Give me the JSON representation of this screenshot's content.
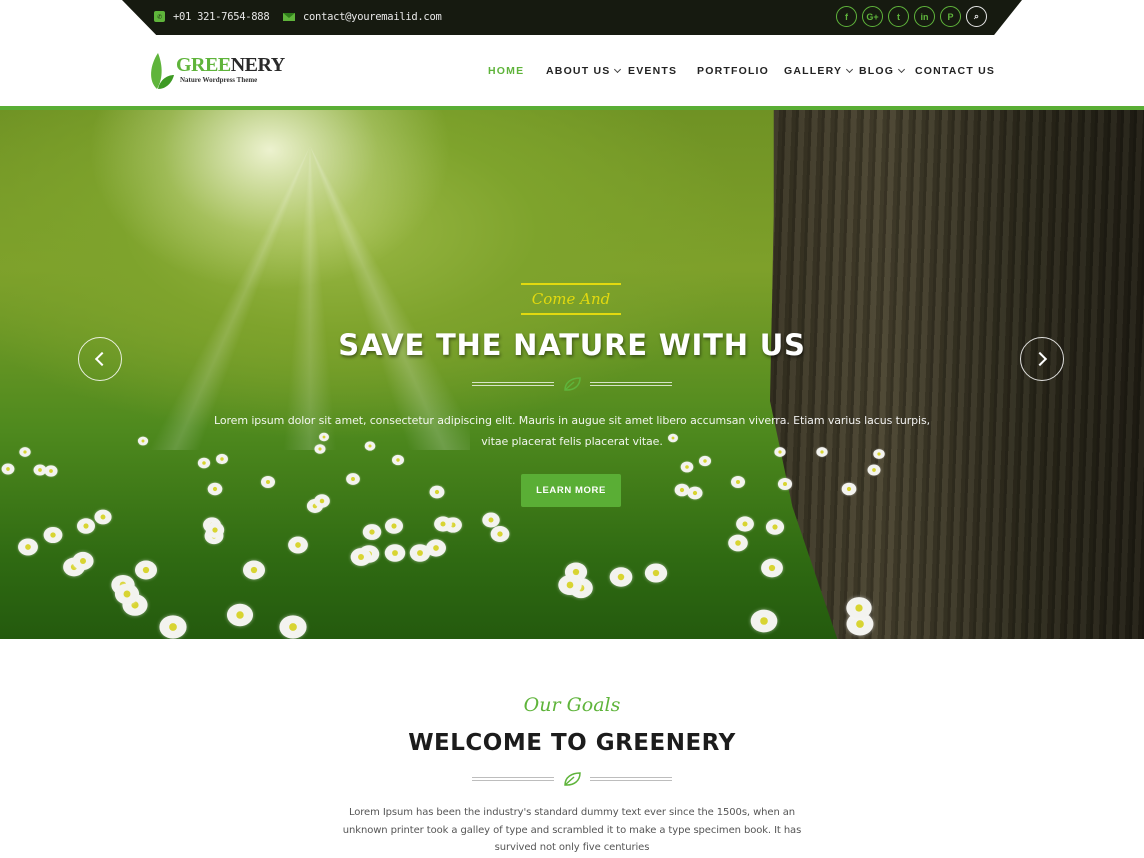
{
  "topbar": {
    "phone": "+01 321-7654-888",
    "email": "contact@youremailid.com",
    "phone_icon": "phone-icon",
    "email_icon": "envelope-icon",
    "socials": [
      {
        "name": "facebook",
        "glyph": "f"
      },
      {
        "name": "google-plus",
        "glyph": "G+"
      },
      {
        "name": "twitter",
        "glyph": "t"
      },
      {
        "name": "linkedin",
        "glyph": "in"
      },
      {
        "name": "pinterest",
        "glyph": "P"
      }
    ],
    "search_glyph": "⌕"
  },
  "logo": {
    "title_part1": "GREE",
    "title_part2": "NERY",
    "subtitle": "Nature Wordpress Theme"
  },
  "nav": {
    "items": [
      {
        "label": "HOME",
        "active": true,
        "dropdown": false
      },
      {
        "label": "ABOUT US",
        "active": false,
        "dropdown": true
      },
      {
        "label": "EVENTS",
        "active": false,
        "dropdown": false
      },
      {
        "label": "PORTFOLIO",
        "active": false,
        "dropdown": false
      },
      {
        "label": "GALLERY",
        "active": false,
        "dropdown": true
      },
      {
        "label": "BLOG",
        "active": false,
        "dropdown": true
      },
      {
        "label": "CONTACT US",
        "active": false,
        "dropdown": false
      }
    ]
  },
  "hero": {
    "kicker": "Come And",
    "title": "SAVE THE NATURE WITH US",
    "description": "Lorem ipsum dolor sit amet, consectetur adipiscing elit. Mauris in augue sit amet libero accumsan viverra. Etiam varius lacus turpis, vitae placerat felis placerat vitae.",
    "button_label": "LEARN MORE"
  },
  "about": {
    "kicker": "Our Goals",
    "title": "WELCOME TO GREENERY",
    "description": "Lorem Ipsum has been the industry's standard dummy text ever since the 1500s, when an unknown printer took a galley of type and scrambled it to make a type specimen book. It has survived not only five centuries"
  },
  "colors": {
    "accent": "#5aae35",
    "topbar": "#161a10",
    "kicker_yellow": "#e2d90f"
  }
}
